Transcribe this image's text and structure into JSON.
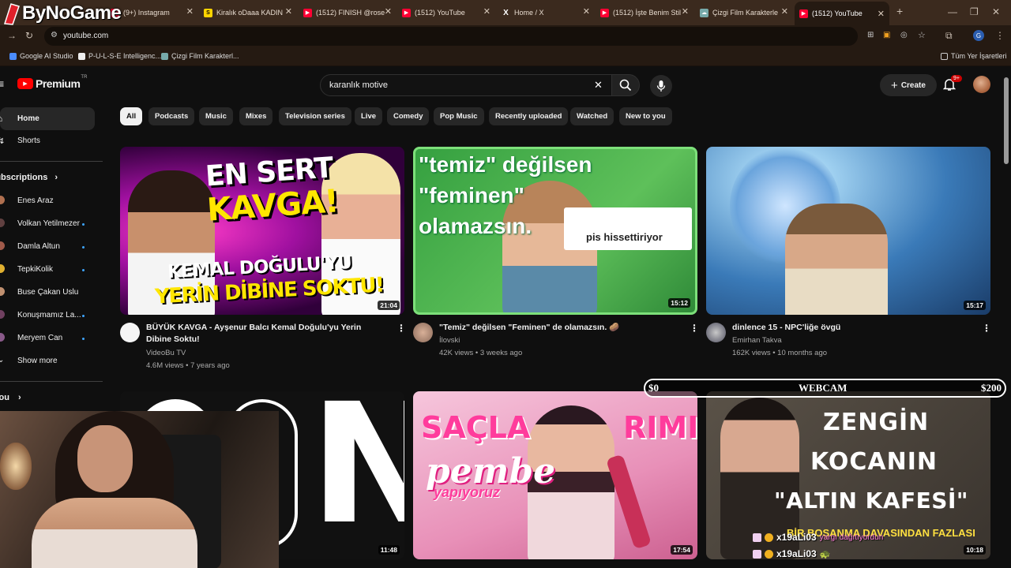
{
  "overlay": {
    "brand": "ByNoGame",
    "webcam_label": "WEBCAM",
    "goal_left": "$0",
    "goal_right": "$200"
  },
  "browser": {
    "tabs": [
      {
        "label": "(9+) Instagram"
      },
      {
        "label": "Kiralık oDaaa KADIN"
      },
      {
        "label": "(1512) FINISH @rose"
      },
      {
        "label": "(1512) YouTube"
      },
      {
        "label": "Home / X"
      },
      {
        "label": "(1512) İşte Benim Stil"
      },
      {
        "label": "Çizgi Film Karakterle"
      },
      {
        "label": "(1512) YouTube"
      }
    ],
    "new_tab": "+",
    "url": "youtube.com",
    "bookmarks": [
      "Google AI Studio",
      "P-U-L-S-E Intelligenc...",
      "Çizgi Film Karakterl..."
    ],
    "all_bookmarks": "Tüm Yer İşaretleri",
    "profile_initial": "G"
  },
  "youtube": {
    "logo": "Premium",
    "logo_country": "TR",
    "search_value": "karanlık motive",
    "create_label": "Create",
    "notifications": "9+",
    "chips": [
      "All",
      "Podcasts",
      "Music",
      "Mixes",
      "Television series",
      "Live",
      "Comedy",
      "Pop Music",
      "Recently uploaded",
      "Watched",
      "New to you"
    ],
    "sidebar": {
      "home": "Home",
      "shorts": "Shorts",
      "subscriptions": "Subscriptions",
      "channels": [
        "Enes Araz",
        "Volkan Yetilmezer",
        "Damla Altun",
        "TepkiKolik",
        "Buse Çakan Uslu",
        "Konuşmamız La...",
        "Meryem Can"
      ],
      "show_more": "Show more",
      "you": "You"
    },
    "videos": [
      {
        "title": "BÜYÜK KAVGA - Ayşenur Balcı Kemal Doğulu'yu Yerin Dibine Soktu!",
        "channel": "VideoBu TV",
        "meta": "4.6M views • 7 years ago",
        "duration": "21:04",
        "thumb_text": [
          "EN SERT",
          "KAVGA!",
          "KEMAL DOĞULU'YU",
          "YERİN DİBİNE SOKTU!"
        ]
      },
      {
        "title": "\"Temiz\" değilsen \"Feminen\" de olamazsın. 🥔",
        "channel": "İlovski",
        "meta": "42K views • 3 weeks ago",
        "duration": "15:12",
        "thumb_text": [
          "\"temiz\" değilsen",
          "\"feminen\"",
          "olamazsın.",
          "pis hissettiriyor"
        ]
      },
      {
        "title": "dinlence 15 - NPC'liğe övgü",
        "channel": "Emirhan Takva",
        "meta": "162K views • 10 months ago",
        "duration": "15:17"
      },
      {
        "duration": "11:48",
        "thumb_text": [
          "N"
        ]
      },
      {
        "duration": "17:54",
        "thumb_text": [
          "SAÇLA",
          "RIMI",
          "pembe",
          "yapıyoruz"
        ]
      },
      {
        "duration": "10:18",
        "thumb_text": [
          "ZENGİN",
          "KOCANIN",
          "\"ALTIN KAFESİ\"",
          "BİR BOŞANMA DAVASINDAN FAZLASI"
        ]
      }
    ],
    "chat": [
      {
        "user": "x19aLi03",
        "msg": "yargı dağıtıyordun"
      },
      {
        "user": "x19aLi03",
        "msg": "🐢"
      }
    ]
  },
  "colors": {
    "brand_red": "#ff0000",
    "link_blue": "#3ea6ff",
    "chrome_brown": "#3b2a1e"
  }
}
